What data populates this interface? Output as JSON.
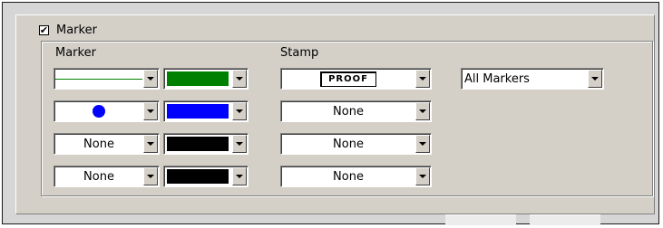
{
  "marker_section": {
    "enabled": true,
    "checkbox_label": "Marker",
    "col_marker_header": "Marker",
    "col_stamp_header": "Stamp"
  },
  "rows": [
    {
      "marker": {
        "type": "line",
        "text": ""
      },
      "color": "#008000",
      "stamp": {
        "type": "proof",
        "text": "PROOF"
      }
    },
    {
      "marker": {
        "type": "dot",
        "text": ""
      },
      "color": "#0000ff",
      "stamp": {
        "type": "text",
        "text": "None"
      }
    },
    {
      "marker": {
        "type": "text",
        "text": "None"
      },
      "color": "#000000",
      "stamp": {
        "type": "text",
        "text": "None"
      }
    },
    {
      "marker": {
        "type": "text",
        "text": "None"
      },
      "color": "#000000",
      "stamp": {
        "type": "text",
        "text": "None"
      }
    }
  ],
  "scope": {
    "selected": "All Markers"
  },
  "icons": {
    "checkbox_check": "check-icon",
    "dropdown": "chevron-down-icon"
  }
}
